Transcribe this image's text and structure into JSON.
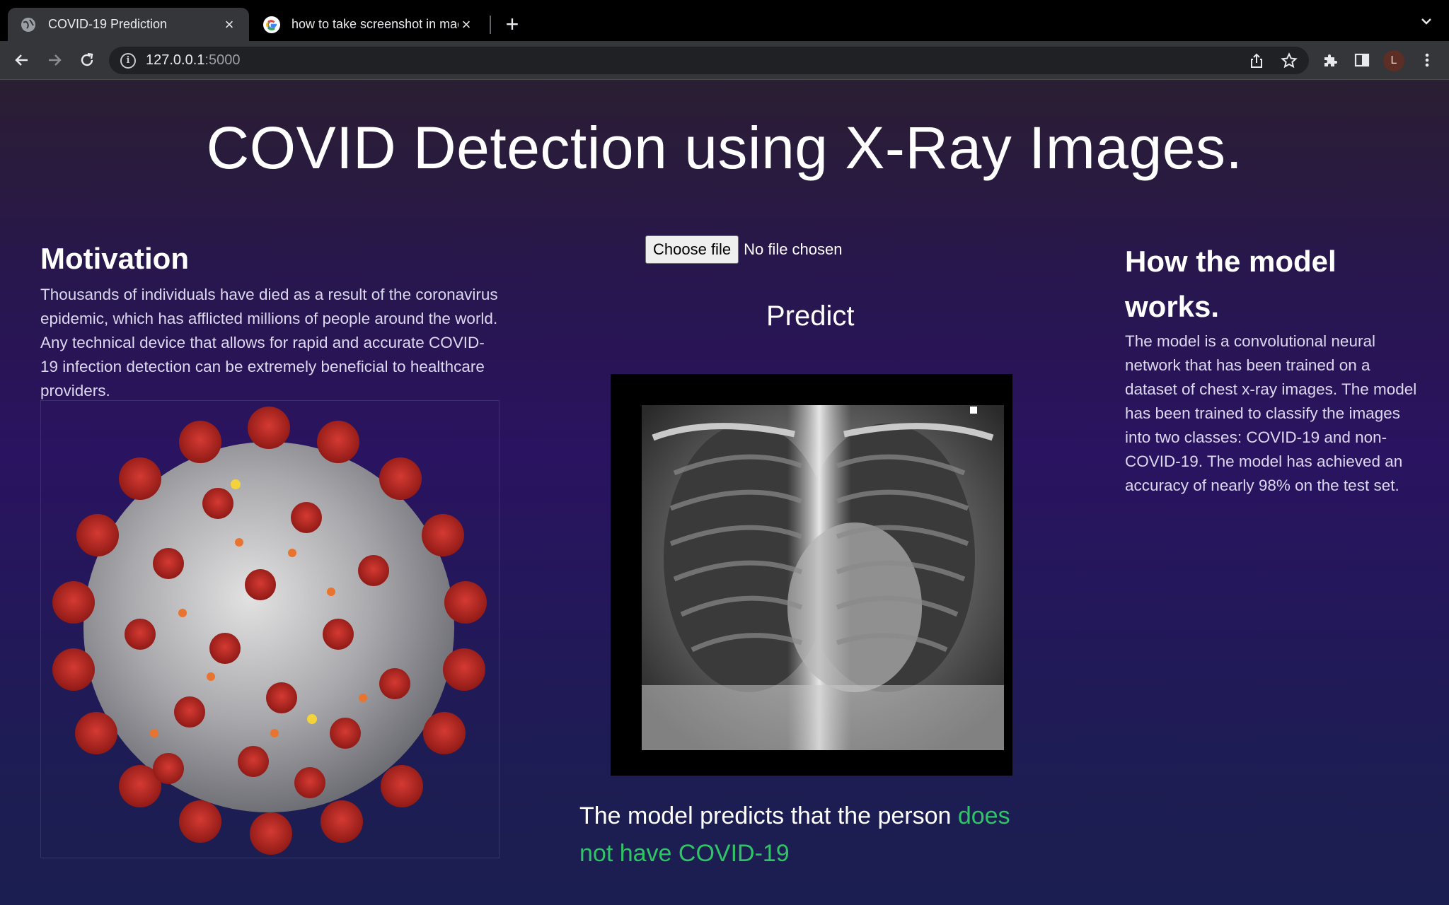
{
  "browser": {
    "tabs": [
      {
        "title": "COVID-19 Prediction",
        "active": true,
        "icon": "globe-icon"
      },
      {
        "title": "how to take screenshot in mac",
        "active": false,
        "icon": "google-icon"
      }
    ],
    "url_host": "127.0.0.1",
    "url_port": ":5000",
    "profile_initial": "L"
  },
  "page": {
    "title": "COVID Detection using X-Ray Images.",
    "motivation": {
      "heading": "Motivation",
      "text": "Thousands of individuals have died as a result of the coronavirus epidemic, which has afflicted millions of people around the world. Any technical device that allows for rapid and accurate COVID-19 infection detection can be extremely beneficial to healthcare providers."
    },
    "upload": {
      "button_label": "Choose file",
      "status": "No file chosen"
    },
    "predict_label": "Predict",
    "result": {
      "prefix": "The model predicts that the person ",
      "outcome": "does not have COVID-19",
      "outcome_color": "#2fc466"
    },
    "model": {
      "heading": "How the model works.",
      "text": "The model is a convolutional neural network that has been trained on a dataset of chest x-ray images. The model has been trained to classify the images into two classes: COVID-19 and non-COVID-19. The model has achieved an accuracy of nearly 98% on the test set."
    }
  }
}
